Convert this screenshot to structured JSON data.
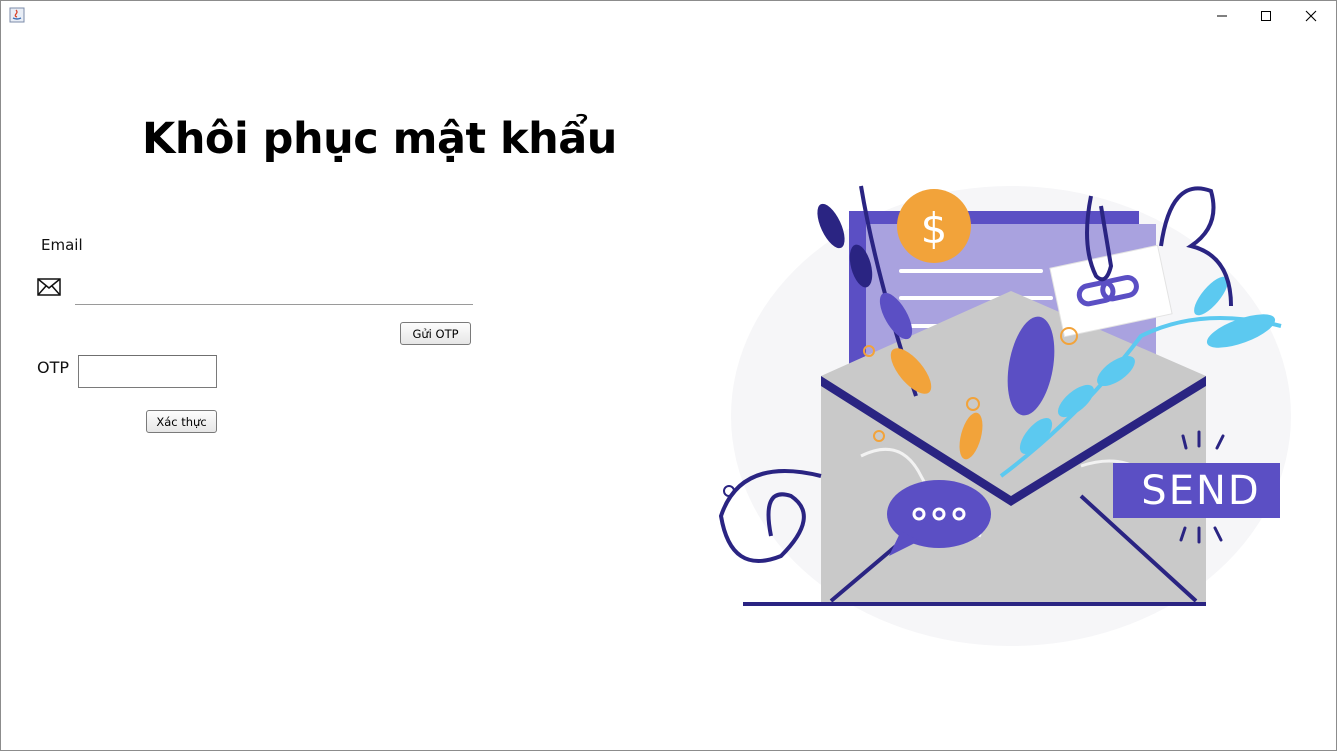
{
  "window": {
    "controls": [
      "minimize",
      "maximize",
      "close"
    ]
  },
  "page": {
    "title": "Khôi phục mật khẩu"
  },
  "form": {
    "email_label": "Email",
    "email_value": "",
    "send_otp_label": "Gửi OTP",
    "otp_label": "OTP",
    "otp_value": "",
    "verify_label": "Xác thực"
  },
  "illustration": {
    "send_label": "SEND",
    "coin_symbol": "$"
  },
  "colors": {
    "accent_purple": "#5b4fc4",
    "dark_navy": "#2a2482",
    "orange": "#f2a33a",
    "cyan": "#5cc9f0",
    "envelope_gray": "#c9c9c9"
  }
}
